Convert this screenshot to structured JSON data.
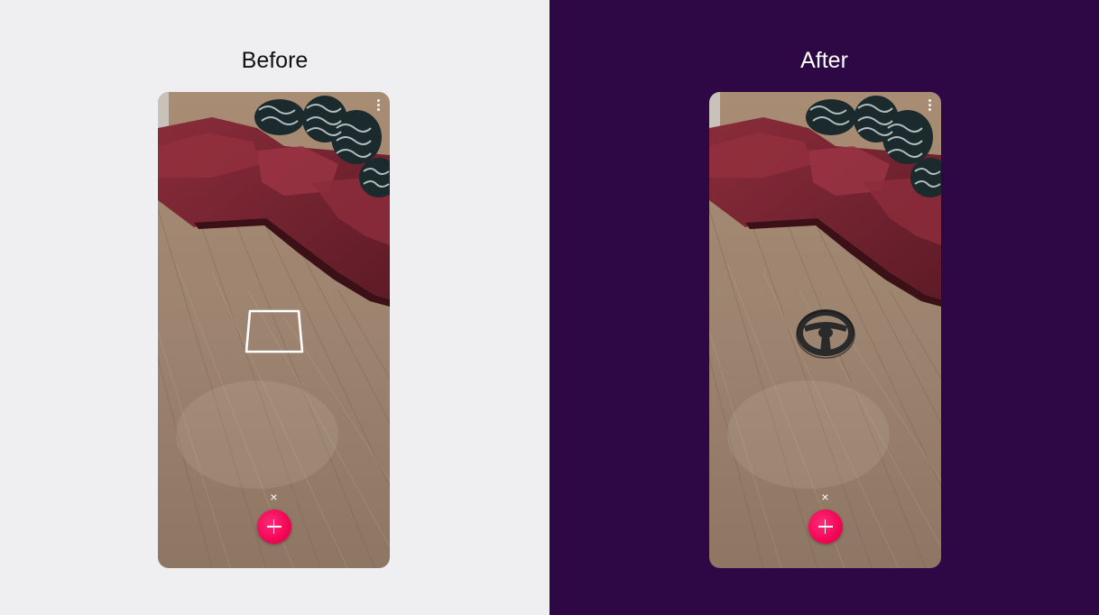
{
  "panels": {
    "before": {
      "title": "Before"
    },
    "after": {
      "title": "After"
    }
  },
  "phone": {
    "close_label": "×",
    "add_icon": "plus-icon",
    "menu_icon": "more-vertical-icon"
  },
  "before_placeholder": {
    "icon": "placement-reticle-icon"
  },
  "after_object": {
    "icon": "steering-wheel-icon"
  },
  "colors": {
    "before_background": "#efeff1",
    "after_background": "#2e0745",
    "accent": "#f0004f",
    "sofa": "#7e2634",
    "floor": "#9a8068"
  }
}
